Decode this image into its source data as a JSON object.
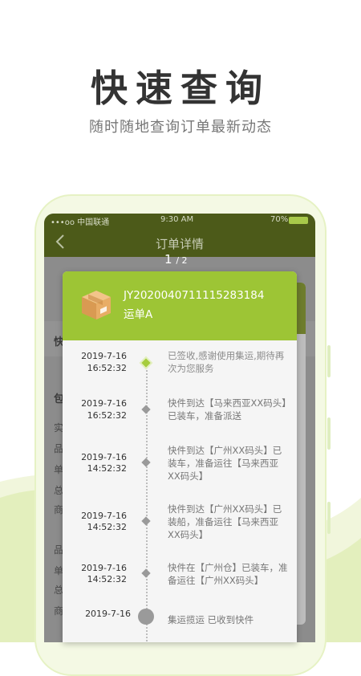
{
  "hero": {
    "title": "快速查询",
    "subtitle": "随时随地查询订单最新动态"
  },
  "status_bar": {
    "carrier": "•••oo 中国联通",
    "time": "9:30 AM",
    "battery": "70%"
  },
  "nav": {
    "title": "订单详情"
  },
  "pager": {
    "current": "1",
    "total": "/ 2"
  },
  "background_rows": {
    "section_a": "快",
    "section_b": "包",
    "chars": [
      "实",
      "品",
      "单",
      "总",
      "商",
      "品",
      "单",
      "总",
      "商"
    ]
  },
  "order": {
    "number": "JY2020040711115283184",
    "name": "运单A"
  },
  "timeline": [
    {
      "date": "2019-7-16",
      "time": "16:52:32",
      "text": "已签收,感谢使用集运,期待再次为您服务",
      "active": true
    },
    {
      "date": "2019-7-16",
      "time": "16:52:32",
      "text": "快件到达【马来西亚XX码头】已装车，准备派送",
      "active": false
    },
    {
      "date": "2019-7-16",
      "time": "14:52:32",
      "text": "快件到达【广州XX码头】已装车，准备运往【马来西亚XX码头】",
      "active": false
    },
    {
      "date": "2019-7-16",
      "time": "14:52:32",
      "text": "快件到达【广州XX码头】已装船，准备运往【马来西亚XX码头】",
      "active": false
    },
    {
      "date": "2019-7-16",
      "time": "14:52:32",
      "text": "快件在【广州仓】已装车，准备运往【广州XX码头】",
      "active": false
    },
    {
      "date": "2019-7-16",
      "time": "",
      "text": "集运揽运 已收到快件",
      "active": false
    }
  ],
  "colors": {
    "accent": "#9dc535",
    "nav_dark": "#4c5a19",
    "wave": "#a9cc52"
  }
}
